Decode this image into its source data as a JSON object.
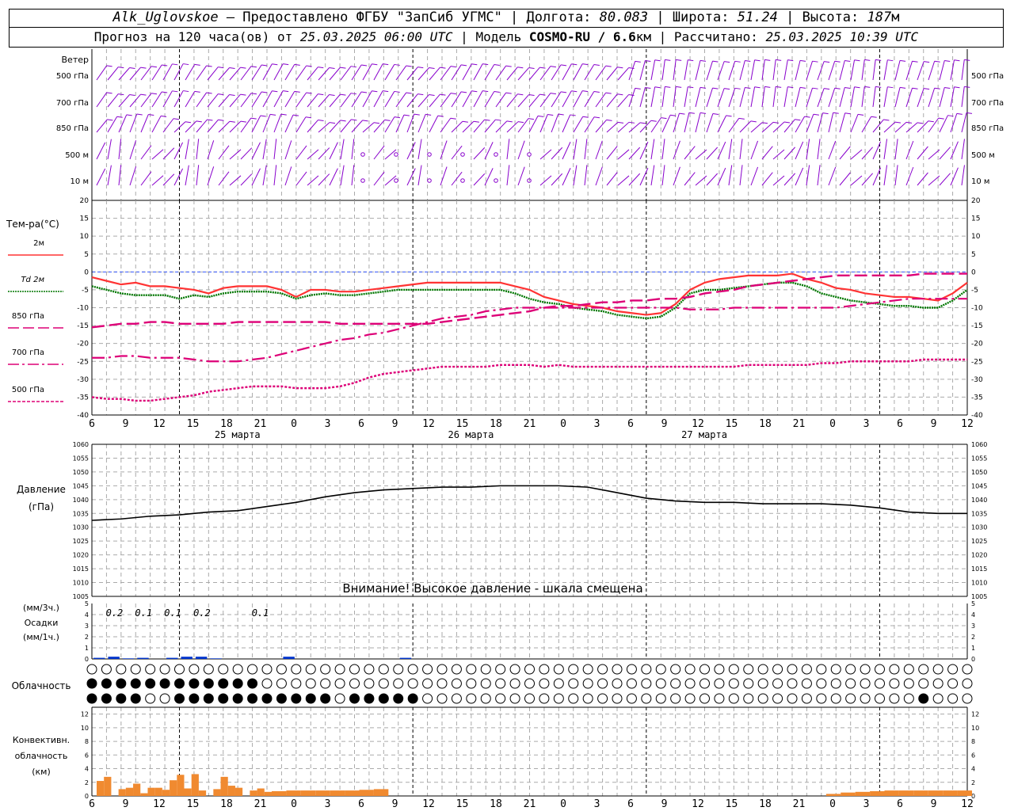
{
  "header": {
    "station": "Alk_Uglovskoe",
    "provider": "— Предоставлено ФГБУ \"ЗапСиб УГМС\"",
    "lon_label": "Долгота:",
    "lon": "80.083",
    "lat_label": "Широта:",
    "lat": "51.24",
    "alt_label": "Высота:",
    "alt": "187",
    "alt_unit": "м",
    "forecast_label": "Прогноз на 120 часа(ов) от",
    "forecast_from": "25.03.2025 06:00 UTC",
    "model_label": "Модель",
    "model": "COSMO-RU / 6.6",
    "model_unit": "км",
    "calc_label": "Рассчитано:",
    "calc_time": "25.03.2025 10:39 UTC"
  },
  "wind_panel": {
    "title": "Ветер",
    "levels": [
      "500 гПа",
      "700 гПа",
      "850 гПа",
      "500 м",
      "10  м"
    ]
  },
  "temp_panel": {
    "title": "Тем-ра(°С)",
    "legend": [
      {
        "label": "2м",
        "color": "#ff3333",
        "style": "solid"
      },
      {
        "label": "Td  2м",
        "color": "#007700",
        "style": "dotted"
      },
      {
        "label": "850 гПа",
        "color": "#dd0077",
        "style": "dash"
      },
      {
        "label": "700 гПа",
        "color": "#dd0077",
        "style": "dashdot"
      },
      {
        "label": "500 гПа",
        "color": "#dd0077",
        "style": "dense"
      }
    ]
  },
  "time_axis": {
    "ticks": [
      "6",
      "9",
      "12",
      "15",
      "18",
      "21",
      "0",
      "3",
      "6",
      "9",
      "12",
      "15",
      "18",
      "21",
      "0",
      "3",
      "6",
      "9",
      "12",
      "15",
      "18",
      "21",
      "0",
      "3",
      "6",
      "9",
      "12"
    ],
    "dates": [
      "25 марта",
      "26 марта",
      "27 марта"
    ]
  },
  "pressure_panel": {
    "title": "Давление",
    "unit": "(гПа)",
    "warning": "Внимание! Высокое давление - шкала смещена"
  },
  "precip_panel": {
    "title_top": "(мм/3ч.)",
    "title_mid": "Осадки",
    "title_bot": "(мм/1ч.)",
    "labels": [
      "0.2",
      "0.1",
      "0.1",
      "0.2",
      "0.1"
    ]
  },
  "cloud_panel": {
    "title": "Облачность"
  },
  "conv_panel": {
    "title1": "Конвективн.",
    "title2": "облачность",
    "title3": "(км)"
  },
  "colors": {
    "temp2m": "#ff3333",
    "dew": "#007700",
    "upper": "#dd0077",
    "wind": "#8800cc",
    "precip": "#0033cc",
    "conv": "#f08a30",
    "zero_line": "#3355ff"
  },
  "chart_data": [
    {
      "type": "line",
      "title": "Тем-ра(°С)",
      "ylim": [
        -40,
        20
      ],
      "y_ticks": [
        20,
        15,
        10,
        5,
        0,
        -5,
        -10,
        -15,
        -20,
        -25,
        -30,
        -35,
        -40
      ],
      "x_hours": [
        0,
        3,
        6,
        9,
        12,
        15,
        18,
        21,
        24,
        27,
        30,
        33,
        36,
        39,
        42,
        45,
        48,
        51,
        54,
        57,
        60,
        63,
        66,
        69,
        72,
        75,
        78,
        81,
        84,
        87,
        90,
        93,
        96,
        99,
        102,
        105,
        108,
        111,
        114,
        117,
        120,
        123,
        126,
        129,
        132,
        135,
        138,
        141,
        144,
        147,
        150,
        153,
        156,
        159,
        162,
        165,
        168,
        171,
        174,
        177,
        180
      ],
      "series": [
        {
          "name": "2м",
          "values": [
            -1.5,
            -2.5,
            -3.5,
            -3,
            -4,
            -4,
            -4.5,
            -5,
            -6,
            -4.5,
            -4,
            -4,
            -4,
            -5,
            -7,
            -5,
            -5,
            -5.5,
            -5.5,
            -5,
            -4.5,
            -4,
            -3.5,
            -3,
            -3,
            -3,
            -3,
            -3,
            -3,
            -4,
            -5,
            -7,
            -8,
            -9,
            -9.5,
            -10,
            -11,
            -11.5,
            -12,
            -11.5,
            -9,
            -5,
            -3,
            -2,
            -1.5,
            -1,
            -1,
            -1,
            -0.5,
            -2,
            -3,
            -4.5,
            -5,
            -6,
            -6.5,
            -7,
            -7,
            -7.5,
            -8,
            -6,
            -3
          ]
        },
        {
          "name": "Td 2м",
          "values": [
            -4,
            -5,
            -6,
            -6.5,
            -6.5,
            -6.5,
            -7.5,
            -6.5,
            -7,
            -6,
            -5.5,
            -5.5,
            -5.5,
            -6,
            -7.5,
            -6.5,
            -6,
            -6.5,
            -6.5,
            -6,
            -5.5,
            -5,
            -5,
            -5,
            -5,
            -5,
            -5,
            -5,
            -5,
            -6,
            -7.5,
            -8.5,
            -9,
            -10,
            -10.5,
            -11,
            -12,
            -12.5,
            -13,
            -12.5,
            -10,
            -6,
            -5,
            -5,
            -4.5,
            -4,
            -3.5,
            -3,
            -3,
            -4,
            -6,
            -7,
            -8,
            -8.5,
            -9,
            -9.5,
            -9.5,
            -10,
            -10,
            -8,
            -5
          ]
        },
        {
          "name": "850 гПа",
          "values": [
            -15.5,
            -15,
            -14.5,
            -14.5,
            -14,
            -14,
            -14.5,
            -14.5,
            -14.5,
            -14.5,
            -14,
            -14,
            -14,
            -14,
            -14,
            -14,
            -14,
            -14.5,
            -14.5,
            -14.5,
            -14.5,
            -14.5,
            -14.5,
            -14.5,
            -14,
            -13.5,
            -13,
            -12.5,
            -12,
            -11.5,
            -11,
            -10,
            -9.5,
            -9.5,
            -9,
            -8.5,
            -8.5,
            -8,
            -8,
            -7.5,
            -7.5,
            -7,
            -6,
            -5.5,
            -5,
            -4,
            -3.5,
            -3,
            -2.5,
            -2,
            -1.5,
            -1,
            -1,
            -1,
            -1,
            -1,
            -1,
            -0.5,
            -0.5,
            -0.5,
            -0.5
          ]
        },
        {
          "name": "700 гПа",
          "values": [
            -24,
            -24,
            -23.5,
            -23.5,
            -24,
            -24,
            -24,
            -24.5,
            -25,
            -25,
            -25,
            -24.5,
            -24,
            -23,
            -22,
            -21,
            -20,
            -19,
            -18.5,
            -17.5,
            -17,
            -16,
            -15,
            -14,
            -13,
            -12.5,
            -12,
            -11,
            -10.5,
            -10,
            -10,
            -10,
            -10,
            -10,
            -10,
            -10,
            -10,
            -10,
            -10,
            -10,
            -10,
            -10.5,
            -10.5,
            -10.5,
            -10,
            -10,
            -10,
            -10,
            -10,
            -10,
            -10,
            -10,
            -9.5,
            -9,
            -8.5,
            -8,
            -7.5,
            -7.5,
            -7.5,
            -7.5,
            -7.5
          ]
        },
        {
          "name": "500 гПа",
          "values": [
            -35,
            -35.5,
            -35.5,
            -36,
            -36,
            -35.5,
            -35,
            -34.5,
            -33.5,
            -33,
            -32.5,
            -32,
            -32,
            -32,
            -32.5,
            -32.5,
            -32.5,
            -32,
            -31,
            -29.5,
            -28.5,
            -28,
            -27.5,
            -27,
            -26.5,
            -26.5,
            -26.5,
            -26.5,
            -26,
            -26,
            -26,
            -26.5,
            -26,
            -26.5,
            -26.5,
            -26.5,
            -26.5,
            -26.5,
            -26.5,
            -26.5,
            -26.5,
            -26.5,
            -26.5,
            -26.5,
            -26.5,
            -26,
            -26,
            -26,
            -26,
            -26,
            -25.5,
            -25.5,
            -25,
            -25,
            -25,
            -25,
            -25,
            -24.5,
            -24.5,
            -24.5,
            -24.5
          ]
        }
      ]
    },
    {
      "type": "line",
      "title": "Давление",
      "ylim": [
        1005,
        1060
      ],
      "y_ticks": [
        1060,
        1055,
        1050,
        1045,
        1040,
        1035,
        1030,
        1025,
        1020,
        1015,
        1010,
        1005
      ],
      "x_hours": [
        0,
        6,
        12,
        18,
        24,
        30,
        36,
        42,
        48,
        54,
        60,
        66,
        72,
        78,
        84,
        90,
        96,
        102,
        108,
        114,
        120,
        126,
        132,
        138,
        144,
        150,
        156,
        162,
        168,
        174,
        180
      ],
      "series": [
        {
          "name": "",
          "values": [
            1032.5,
            1033,
            1034,
            1034.5,
            1035.5,
            1036,
            1037.5,
            1039,
            1041,
            1042.5,
            1043.5,
            1044,
            1044.5,
            1044.5,
            1045,
            1045,
            1045,
            1044.5,
            1042.5,
            1040.5,
            1039.5,
            1039,
            1039,
            1038.5,
            1038.5,
            1038.5,
            1038,
            1037,
            1035.5,
            1035,
            1035
          ]
        }
      ]
    },
    {
      "type": "bar",
      "title": "Осадки",
      "ylim": [
        0,
        5
      ],
      "x_hours": [
        0,
        3,
        6,
        9,
        12,
        15,
        18,
        21,
        24,
        27,
        30,
        33,
        36,
        39,
        42,
        45,
        48,
        51,
        54,
        57,
        60,
        63,
        66,
        69,
        72,
        75
      ],
      "values": [
        0.1,
        0.2,
        0.05,
        0.1,
        0,
        0.1,
        0.2,
        0.2,
        0.05,
        0,
        0,
        0,
        0,
        0.2,
        0,
        0,
        0,
        0,
        0,
        0,
        0,
        0.1,
        0,
        0,
        0,
        0
      ]
    },
    {
      "type": "bar",
      "title": "Конвективн. облачность (км)",
      "ylim": [
        0,
        13
      ],
      "y_ticks": [
        0,
        2,
        4,
        6,
        8,
        10,
        12
      ],
      "x_hours": [
        0,
        1.5,
        3,
        4.5,
        6,
        7.5,
        9,
        10.5,
        12,
        13.5,
        15,
        16.5,
        18,
        19.5,
        21,
        22.5,
        24,
        25.5,
        27,
        28.5,
        30,
        31.5,
        33,
        34.5,
        36,
        39,
        42,
        45,
        48,
        51,
        54,
        57,
        60,
        63,
        66,
        69,
        72,
        75,
        78,
        81,
        84,
        87,
        90,
        93,
        96,
        99,
        102,
        105,
        108,
        111,
        114,
        117,
        120,
        123,
        126,
        129,
        132,
        135,
        138,
        141,
        144,
        147,
        150,
        153,
        156,
        159,
        162,
        165,
        168,
        171,
        174,
        177
      ],
      "values": [
        2.2,
        2.8,
        0,
        1,
        1.2,
        1.8,
        0.4,
        1.2,
        1.2,
        0.9,
        2.3,
        3.1,
        1.1,
        3.2,
        0.8,
        0,
        1,
        2.8,
        1.5,
        1.2,
        0,
        0.8,
        1.1,
        0.6,
        0.7,
        0.8,
        0.8,
        0.8,
        0.8,
        0.8,
        0.9,
        1,
        0,
        0,
        0,
        0,
        0,
        0,
        0,
        0,
        0,
        0,
        0,
        0,
        0,
        0,
        0,
        0,
        0,
        0,
        0,
        0,
        0,
        0,
        0,
        0,
        0,
        0,
        0,
        0,
        0,
        0,
        0.3,
        0.5,
        0.6,
        0.7,
        0.8,
        0.8,
        0.8,
        0.8,
        0.8,
        0.8
      ]
    }
  ]
}
